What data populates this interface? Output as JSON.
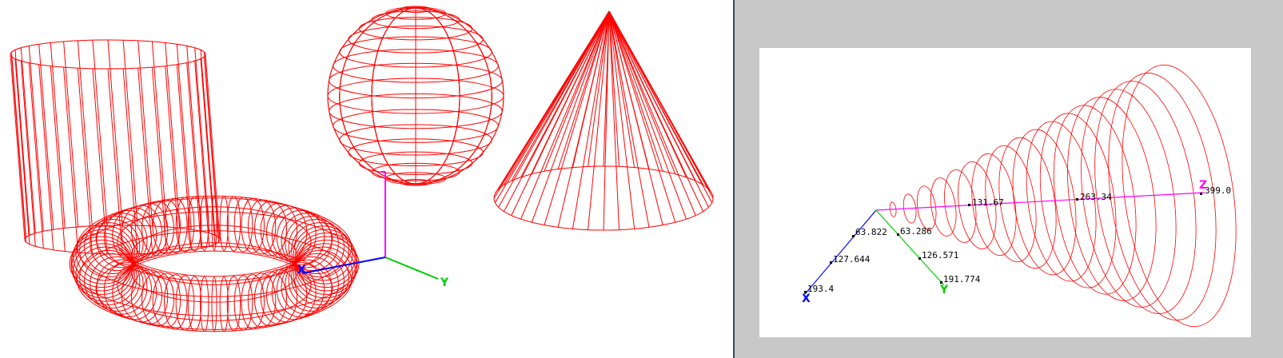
{
  "colors": {
    "wire": "#ff0000",
    "axis_x": "#0000ff",
    "axis_y": "#00cc00",
    "axis_z": "#ff00ff",
    "panel_bg": "#c8c8c8",
    "divider": "#3a4a5a"
  },
  "left_view": {
    "shapes": [
      "cylinder",
      "sphere",
      "cone",
      "torus"
    ],
    "axes": {
      "x_label": "X",
      "y_label": "Y"
    }
  },
  "right_view": {
    "axes": {
      "x_label": "X",
      "y_label": "Y",
      "z_label": "Z"
    },
    "x_ticks": [
      "63.822",
      "127.644",
      "193.4"
    ],
    "y_ticks": [
      "63.286",
      "126.571",
      "191.774"
    ],
    "z_ticks": [
      "131.67",
      "263.34",
      "399.0"
    ]
  }
}
